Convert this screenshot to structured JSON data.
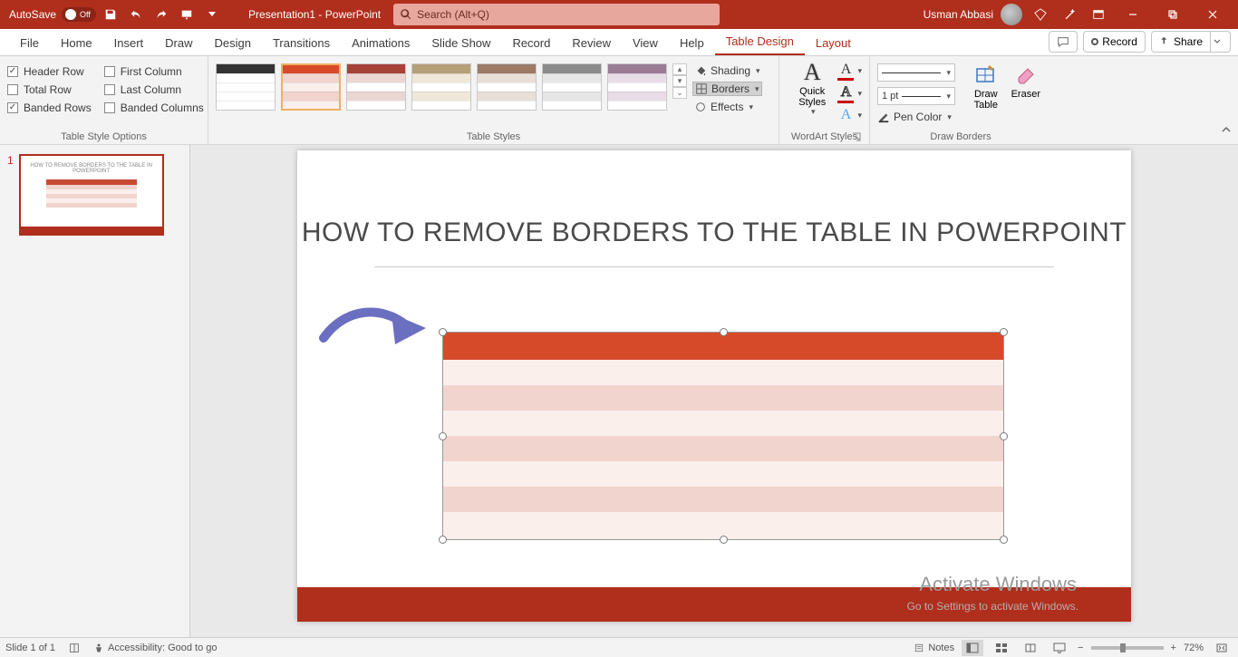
{
  "titlebar": {
    "autosave_label": "AutoSave",
    "autosave_state": "Off",
    "doc_name": "Presentation1 - PowerPoint",
    "search_placeholder": "Search (Alt+Q)",
    "user_name": "Usman Abbasi"
  },
  "ribbon_tabs": {
    "items": [
      "File",
      "Home",
      "Insert",
      "Draw",
      "Design",
      "Transitions",
      "Animations",
      "Slide Show",
      "Record",
      "Review",
      "View",
      "Help",
      "Table Design",
      "Layout"
    ],
    "active": "Table Design",
    "record_label": "Record",
    "share_label": "Share"
  },
  "ribbon": {
    "style_options": {
      "label": "Table Style Options",
      "header_row": "Header Row",
      "total_row": "Total Row",
      "banded_rows": "Banded Rows",
      "first_column": "First Column",
      "last_column": "Last Column",
      "banded_columns": "Banded Columns",
      "checked": {
        "header_row": true,
        "total_row": false,
        "banded_rows": true,
        "first_column": false,
        "last_column": false,
        "banded_columns": false
      }
    },
    "table_styles": {
      "label": "Table Styles"
    },
    "style_tools": {
      "shading": "Shading",
      "borders": "Borders",
      "effects": "Effects"
    },
    "wordart": {
      "label": "WordArt Styles",
      "quick": "Quick Styles"
    },
    "draw_borders": {
      "label": "Draw Borders",
      "line_weight": "1 pt",
      "pen_color": "Pen Color",
      "draw_table": "Draw Table",
      "eraser": "Eraser"
    }
  },
  "rail": {
    "slide_num": "1"
  },
  "slide": {
    "title": "HOW TO REMOVE BORDERS TO THE TABLE IN POWERPOINT",
    "watermark_title": "Activate Windows",
    "watermark_sub": "Go to Settings to activate Windows."
  },
  "status": {
    "slide_pos": "Slide 1 of 1",
    "accessibility": "Accessibility: Good to go",
    "notes": "Notes",
    "zoom": "72%"
  },
  "colors": {
    "accent": "#b02e1c",
    "table_header": "#d64a29",
    "band1": "#f2d4cf",
    "band2": "#fbefec"
  }
}
